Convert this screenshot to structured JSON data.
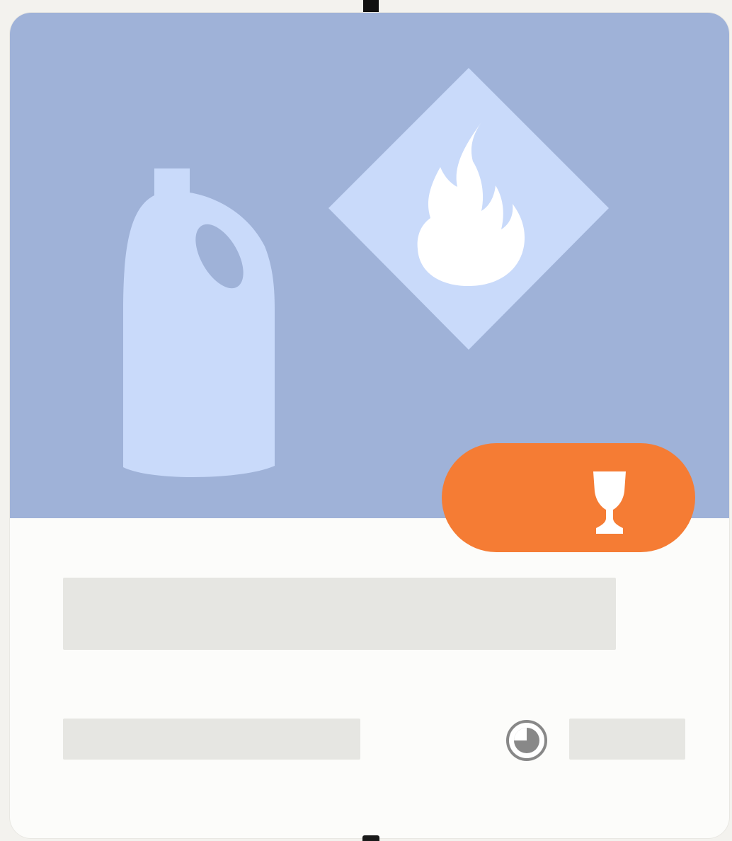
{
  "card": {
    "hero_icons": [
      "bottle-icon",
      "flammable-diamond-icon",
      "flame-icon"
    ],
    "badge_icon": "goblet-icon",
    "meta_icon": "clock-icon",
    "title_text": "",
    "meta_text": "",
    "time_text": ""
  },
  "colors": {
    "page_background": "#f3f2ee",
    "card_background": "#fcfcfa",
    "hero_background": "#9fb2d8",
    "icon_light_blue": "#c9dafa",
    "badge_orange": "#f57c34",
    "skeleton_gray": "#e6e6e2"
  }
}
